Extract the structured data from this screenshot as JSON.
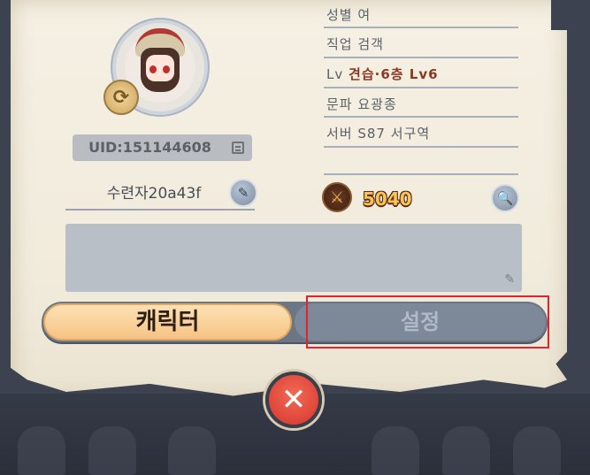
{
  "profile": {
    "uid": "UID:151144608",
    "nickname": "수련자20a43f"
  },
  "info": {
    "gender": "성별 여",
    "job": "직업 검객",
    "lv_label": "Lv",
    "lv_value": "견습·6층 Lv6",
    "sect": "문파 요광종",
    "server": "서버 S87 서구역"
  },
  "power": {
    "value": "5040"
  },
  "tabs": {
    "character": "캐릭터",
    "settings": "설정"
  },
  "icons": {
    "swap": "swap-icon",
    "copy": "copy-icon",
    "edit": "pen-icon",
    "search": "magnifier-icon",
    "power": "crossed-swords-icon",
    "close": "close-icon"
  },
  "colors": {
    "highlight": "#e0242e",
    "power": "#f7c456",
    "close": "#e04a3c"
  }
}
